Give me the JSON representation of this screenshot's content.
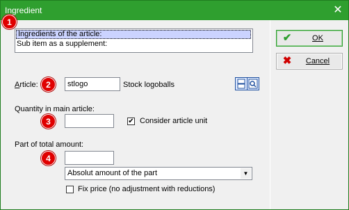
{
  "window": {
    "title": "Ingredient",
    "close_glyph": "✕"
  },
  "markers": [
    "1",
    "2",
    "3",
    "4"
  ],
  "list": {
    "items": [
      "Ingredients of the article:",
      "Sub item as a supplement:"
    ]
  },
  "article": {
    "label": "Article:",
    "value": "stlogo",
    "description": "Stock logoballs"
  },
  "quantity": {
    "label": "Quantity in main article:",
    "value": "",
    "consider_unit_label": "Consider article unit",
    "consider_unit_checked": true
  },
  "part": {
    "label": "Part of total amount:",
    "value": "",
    "select_value": "Absolut amount of the part",
    "fix_price_label": "Fix price (no adjustment with reductions)",
    "fix_price_checked": false
  },
  "buttons": {
    "ok": "OK",
    "cancel": "Cancel"
  },
  "colors": {
    "titlebar": "#2f9f2f",
    "marker": "#e00000",
    "selection": "#cbd3ff"
  },
  "icons": {
    "ok": "checkmark-icon",
    "cancel": "cross-icon",
    "tool1": "list-icon",
    "tool2": "search-icon"
  }
}
